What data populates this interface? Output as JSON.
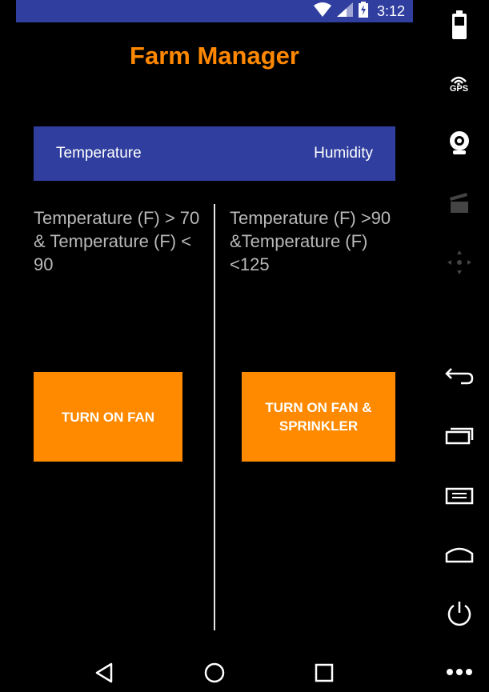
{
  "status_bar": {
    "time": "3:12"
  },
  "app": {
    "title": "Farm Manager"
  },
  "tabs": {
    "temperature_label": "Temperature",
    "humidity_label": "Humidity"
  },
  "rules": {
    "left_text": "Temperature (F) > 70 & Temperature (F) < 90",
    "right_text": "Temperature (F) >90 &Temperature (F) <125"
  },
  "buttons": {
    "fan_label": "TURN ON FAN",
    "fan_sprinkler_label": "TURN ON FAN & SPRINKLER"
  },
  "side_toolbar": {
    "gps_label": "GPS"
  },
  "colors": {
    "accent": "#ff8800",
    "header": "#303f9f",
    "background": "#000000",
    "rule_text": "#b8b8b8"
  },
  "icons": [
    "wifi-icon",
    "signal-icon",
    "battery-charging-icon",
    "battery-icon",
    "gps-icon",
    "camera-icon",
    "video-icon",
    "dpad-icon",
    "back-icon",
    "recents-icon",
    "menu-icon",
    "home-icon",
    "power-icon",
    "more-icon",
    "nav-back-icon",
    "nav-home-icon",
    "nav-recents-icon"
  ]
}
